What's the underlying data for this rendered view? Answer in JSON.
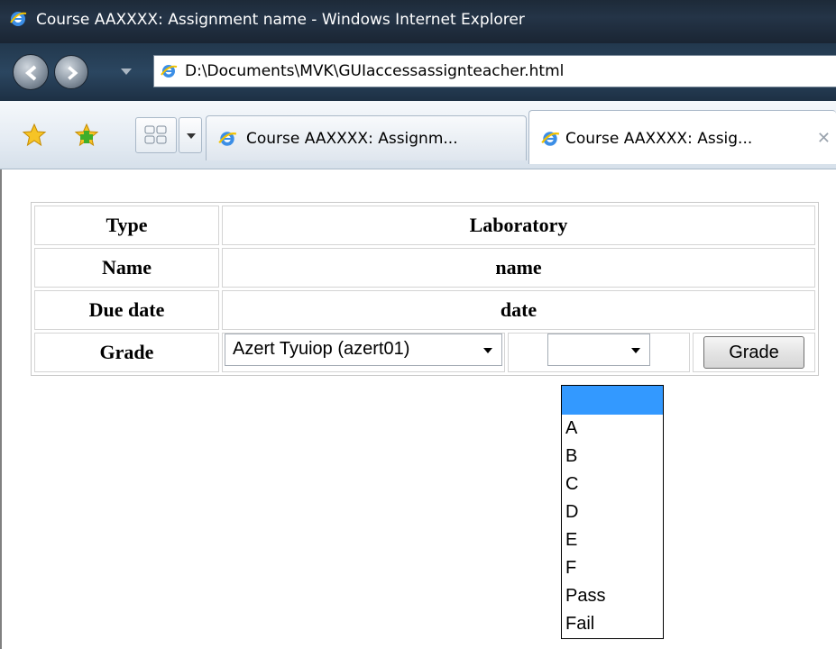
{
  "window": {
    "title": "Course AAXXXX: Assignment name - Windows Internet Explorer"
  },
  "navigation": {
    "url": "D:\\Documents\\MVK\\GUIaccessassignteacher.html"
  },
  "tabs": [
    {
      "label": "Course AAXXXX: Assignm...",
      "active": false
    },
    {
      "label": "Course AAXXXX: Assig...",
      "active": true
    }
  ],
  "assignment": {
    "rows": [
      {
        "label": "Type",
        "value": "Laboratory"
      },
      {
        "label": "Name",
        "value": "name"
      },
      {
        "label": "Due date",
        "value": "date"
      }
    ],
    "grade_label": "Grade",
    "student_select": "Azert Tyuiop (azert01)",
    "grade_select": "",
    "grade_button": "Grade"
  },
  "grade_options": [
    "",
    "A",
    "B",
    "C",
    "D",
    "E",
    "F",
    "Pass",
    "Fail"
  ],
  "colors": {
    "selected_option": "#3399ff",
    "titlebar": "#243447"
  }
}
